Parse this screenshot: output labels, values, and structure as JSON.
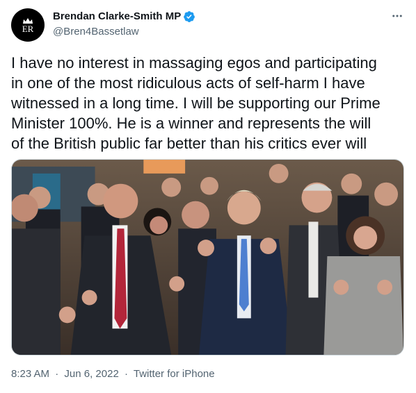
{
  "author": {
    "display_name": "Brendan Clarke-Smith MP",
    "handle": "@Bren4Bassetlaw",
    "avatar_text": "ER",
    "verified": true
  },
  "tweet": {
    "text": "I have no interest in massaging egos and participating\nin one of the most ridiculous acts of self-harm I have\nwitnessed in a long time. I will be supporting our Prime\nMinister 100%. He is a winner and represents the will\nof the British public far better than his critics ever will",
    "time": "8:23 AM",
    "date": "Jun 6, 2022",
    "separator": "·",
    "source": "Twitter for iPhone"
  },
  "icons": {
    "more": "more-horizontal-icon",
    "verified": "verified-badge-icon"
  },
  "colors": {
    "text": "#0f1419",
    "secondary": "#536471",
    "verified": "#1d9bf0"
  }
}
